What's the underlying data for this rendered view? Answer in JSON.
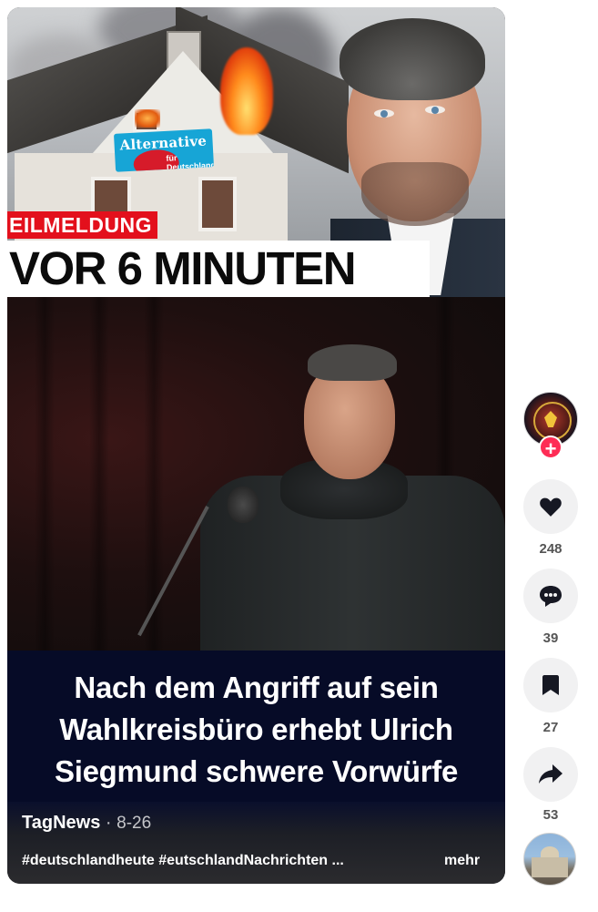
{
  "thumbnail": {
    "banner_text": "Alternative",
    "banner_subtext": "für Deutschland",
    "breaking_label": "EILMELDUNG",
    "headline": "VOR 6 MINUTEN"
  },
  "caption": {
    "lines": [
      "Nach dem Angriff auf sein",
      "Wahlkreisbüro erhebt Ulrich",
      "Siegmund schwere Vorwürfe"
    ]
  },
  "post": {
    "author": "TagNews",
    "separator": "·",
    "date": "8-26",
    "description": "#deutschlandheute #eutschlandNachrichten ...",
    "more_label": "mehr"
  },
  "actions": {
    "follow_symbol": "+",
    "likes": "248",
    "comments": "39",
    "bookmarks": "27",
    "shares": "53",
    "icons": [
      "heart-icon",
      "comment-icon",
      "bookmark-icon",
      "share-icon"
    ]
  },
  "colors": {
    "accent": "#fe2c55",
    "breaking_red": "#e3101c",
    "caption_bg": "#060b27"
  }
}
